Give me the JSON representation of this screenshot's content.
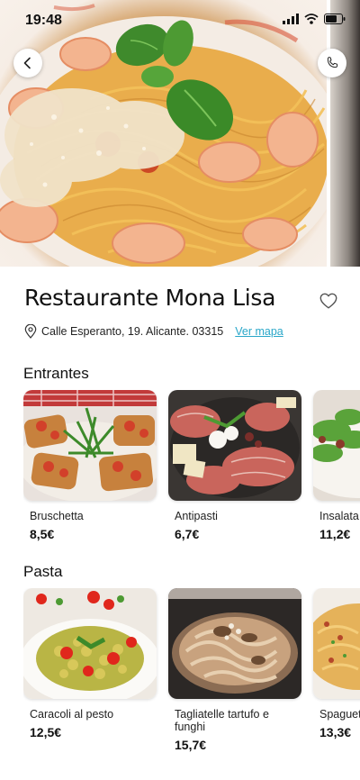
{
  "status_bar": {
    "time": "19:48"
  },
  "restaurant": {
    "name": "Restaurante Mona Lisa",
    "address": "Calle Esperanto, 19. Alicante. 03315",
    "map_link": "Ver mapa"
  },
  "sections": [
    {
      "title": "Entrantes",
      "items": [
        {
          "name": "Bruschetta",
          "price": "8,5€"
        },
        {
          "name": "Antipasti",
          "price": "6,7€"
        },
        {
          "name": "Insalata",
          "price": "11,2€"
        }
      ]
    },
    {
      "title": "Pasta",
      "items": [
        {
          "name": "Caracoli al pesto",
          "price": "12,5€"
        },
        {
          "name": "Tagliatelle tartufo e funghi",
          "price": "15,7€"
        },
        {
          "name": "Spaguetti carbonara",
          "price": "13,3€"
        }
      ]
    }
  ],
  "icons": {
    "back": "chevron-left-icon",
    "call": "phone-icon",
    "favorite": "heart-icon",
    "location": "map-pin-icon"
  },
  "colors": {
    "link": "#2aa7c9",
    "text": "#111111"
  }
}
